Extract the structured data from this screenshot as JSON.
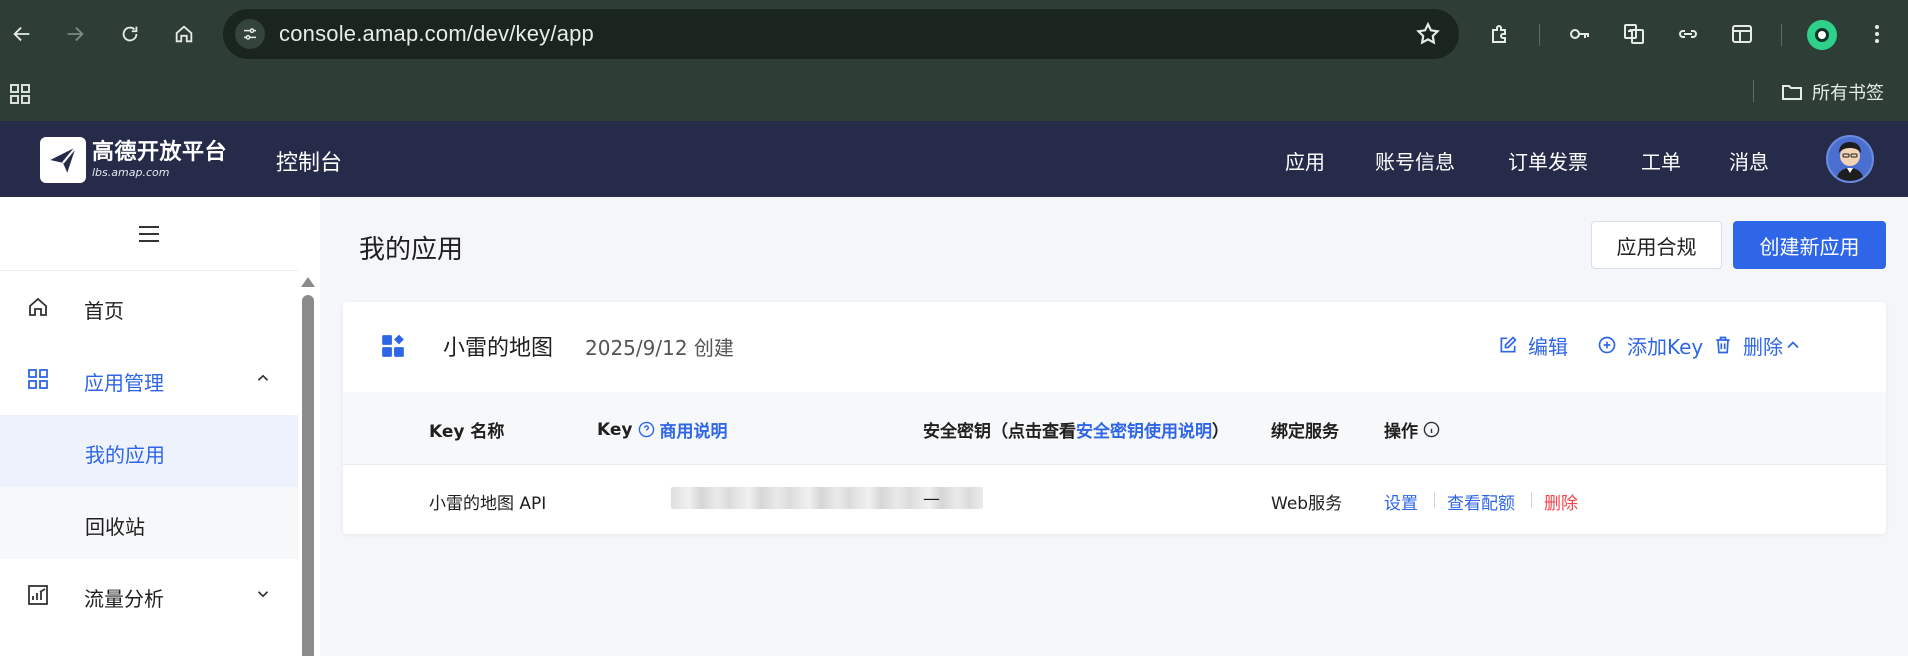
{
  "browser": {
    "url": "console.amap.com/dev/key/app",
    "bookmarks_folder": "所有书签"
  },
  "header": {
    "logo_name": "高德开放平台",
    "logo_domain": "lbs.amap.com",
    "console_title": "控制台",
    "nav": [
      "应用",
      "账号信息",
      "订单发票",
      "工单",
      "消息"
    ]
  },
  "sidebar": {
    "home": "首页",
    "app_management": "应用管理",
    "my_apps": "我的应用",
    "recycle_bin": "回收站",
    "traffic_analysis": "流量分析"
  },
  "main": {
    "title": "我的应用",
    "compliance_button": "应用合规",
    "create_button": "创建新应用",
    "app": {
      "name": "小雷的地图",
      "created": "2025/9/12 创建",
      "actions": {
        "edit": "编辑",
        "add_key": "添加Key",
        "delete": "删除"
      }
    },
    "table": {
      "col_name": "Key 名称",
      "col_key": "Key",
      "col_key_link": "商用说明",
      "col_secret_prefix": "安全密钥（点击查看",
      "col_secret_link": "安全密钥使用说明",
      "col_secret_suffix": "）",
      "col_service": "绑定服务",
      "col_ops": "操作",
      "rows": [
        {
          "name": "小雷的地图 API",
          "secret": "—",
          "service": "Web服务",
          "op_settings": "设置",
          "op_quota": "查看配额",
          "op_delete": "删除"
        }
      ]
    }
  },
  "colors": {
    "primary": "#2f66e8",
    "header_bg": "#262b4a",
    "danger": "#f2434b",
    "chrome_bg": "#2e3e36"
  }
}
